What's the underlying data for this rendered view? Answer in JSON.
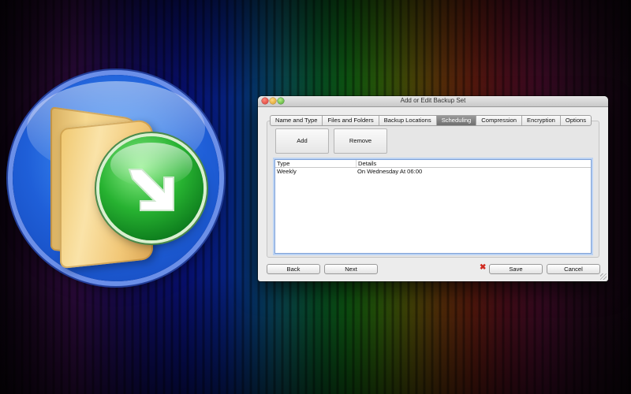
{
  "window": {
    "title": "Add or Edit Backup Set"
  },
  "tabs": [
    {
      "label": "Name and Type",
      "active": false
    },
    {
      "label": "Files and Folders",
      "active": false
    },
    {
      "label": "Backup Locations",
      "active": false
    },
    {
      "label": "Scheduling",
      "active": true
    },
    {
      "label": "Compression",
      "active": false
    },
    {
      "label": "Encryption",
      "active": false
    },
    {
      "label": "Options",
      "active": false
    }
  ],
  "toolbar": {
    "add_label": "Add",
    "remove_label": "Remove"
  },
  "schedule_table": {
    "columns": [
      "Type",
      "Details"
    ],
    "rows": [
      [
        "Weekly",
        "On Wednesday At 06:00"
      ]
    ]
  },
  "footer": {
    "back_label": "Back",
    "next_label": "Next",
    "save_label": "Save",
    "cancel_label": "Cancel",
    "error_icon": "red-x-icon"
  },
  "icons": {
    "app_icon": "folder-with-green-arrow-icon"
  },
  "colors": {
    "active_tab": "#7a7a7a",
    "error": "#d02a20",
    "selection_border": "#7fa2d8"
  }
}
